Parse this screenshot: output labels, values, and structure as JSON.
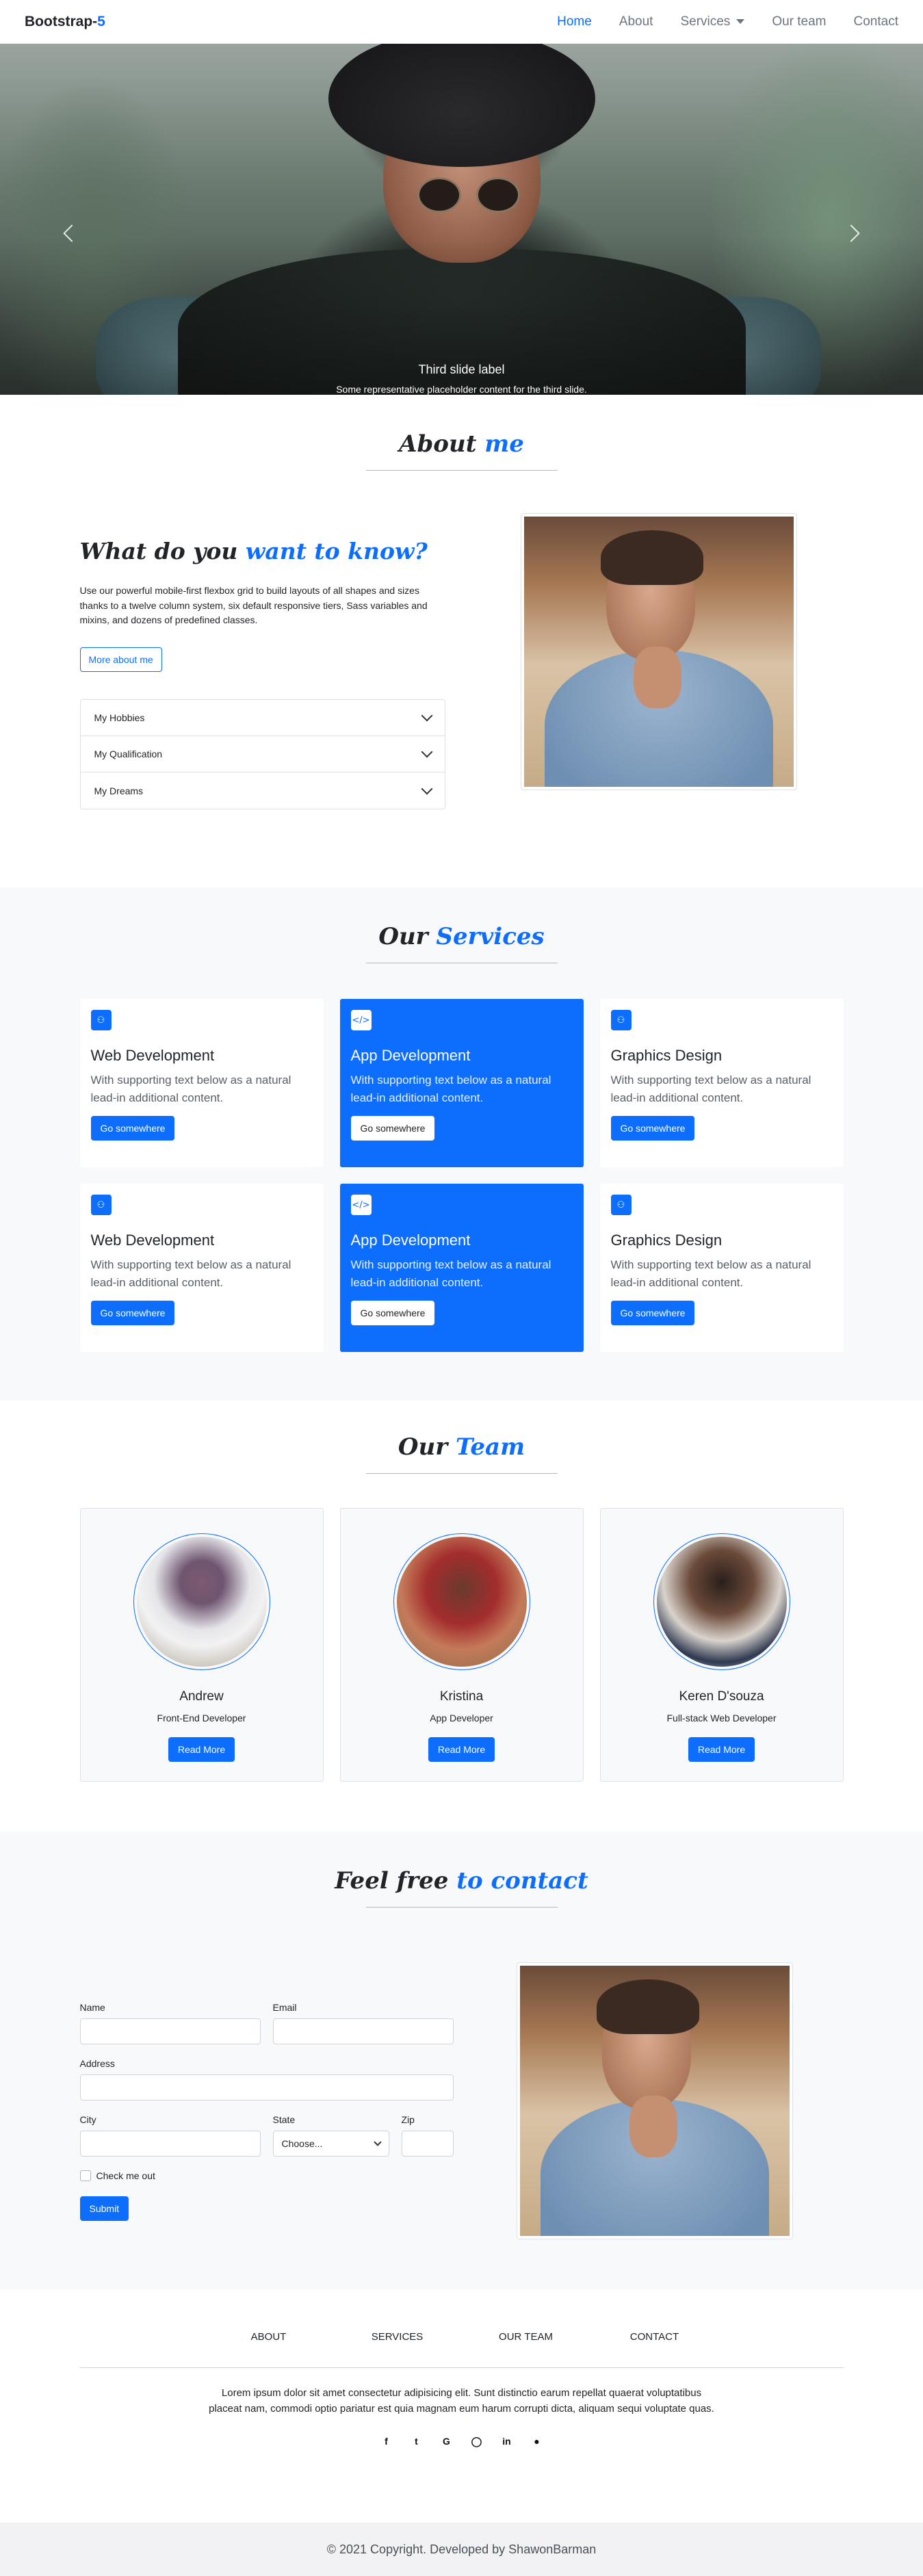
{
  "nav": {
    "brand_main": "Bootstrap-",
    "brand_accent": "5",
    "links": [
      {
        "label": "Home"
      },
      {
        "label": "About"
      },
      {
        "label": "Services"
      },
      {
        "label": "Our team"
      },
      {
        "label": "Contact"
      }
    ]
  },
  "hero": {
    "caption_title": "Third slide label",
    "caption_text": "Some representative placeholder content for the third slide.",
    "indicators_total": 4,
    "active_indicator": 3
  },
  "about": {
    "title_main": "About",
    "title_accent": "me",
    "heading_main": "What do you",
    "heading_accent": "want to know?",
    "paragraph": "Use our powerful mobile-first flexbox grid to build layouts of all shapes and sizes thanks to a twelve column system, six default responsive tiers, Sass variables and mixins, and dozens of predefined classes.",
    "button": "More about me",
    "accordion": [
      "My Hobbies",
      "My Qualification",
      "My Dreams"
    ]
  },
  "services": {
    "title_main": "Our",
    "title_accent": "Services",
    "cards": [
      {
        "title": "Web Development",
        "text": "With supporting text below as a natural lead-in additional content.",
        "button": "Go somewhere",
        "icon": "people-icon"
      },
      {
        "title": "App Development",
        "text": "With supporting text below as a natural lead-in additional content.",
        "button": "Go somewhere",
        "icon": "code-icon"
      },
      {
        "title": "Graphics Design",
        "text": "With supporting text below as a natural lead-in additional content.",
        "button": "Go somewhere",
        "icon": "group-icon"
      },
      {
        "title": "Web Development",
        "text": "With supporting text below as a natural lead-in additional content.",
        "button": "Go somewhere",
        "icon": "people-icon"
      },
      {
        "title": "App Development",
        "text": "With supporting text below as a natural lead-in additional content.",
        "button": "Go somewhere",
        "icon": "code-icon"
      },
      {
        "title": "Graphics Design",
        "text": "With supporting text below as a natural lead-in additional content.",
        "button": "Go somewhere",
        "icon": "group-icon"
      }
    ]
  },
  "team": {
    "title_main": "Our",
    "title_accent": "Team",
    "members": [
      {
        "name": "Andrew",
        "role": "Front-End Developer",
        "button": "Read More"
      },
      {
        "name": "Kristina",
        "role": "App Developer",
        "button": "Read More"
      },
      {
        "name": "Keren D'souza",
        "role": "Full-stack Web Developer",
        "button": "Read More"
      }
    ]
  },
  "contact": {
    "title_main": "Feel free",
    "title_accent": "to contact",
    "labels": {
      "name": "Name",
      "email": "Email",
      "address": "Address",
      "city": "City",
      "state": "State",
      "zip": "Zip"
    },
    "state_selected": "Choose...",
    "check_label": "Check me out",
    "submit": "Submit"
  },
  "footer": {
    "links": [
      "About",
      "Services",
      "Our team",
      "Contact"
    ],
    "text": "Lorem ipsum dolor sit amet consectetur adipisicing elit. Sunt distinctio earum repellat quaerat voluptatibus placeat nam, commodi optio pariatur est quia magnam eum harum corrupti dicta, aliquam sequi voluptate quas.",
    "socials": [
      "facebook-icon",
      "twitter-icon",
      "google-icon",
      "instagram-icon",
      "linkedin-icon",
      "github-icon"
    ],
    "copyright": "© 2021 Copyright. Developed by ShawonBarman"
  },
  "colors": {
    "accent": "#0d6efd",
    "light_bg": "#f8f9fa"
  }
}
